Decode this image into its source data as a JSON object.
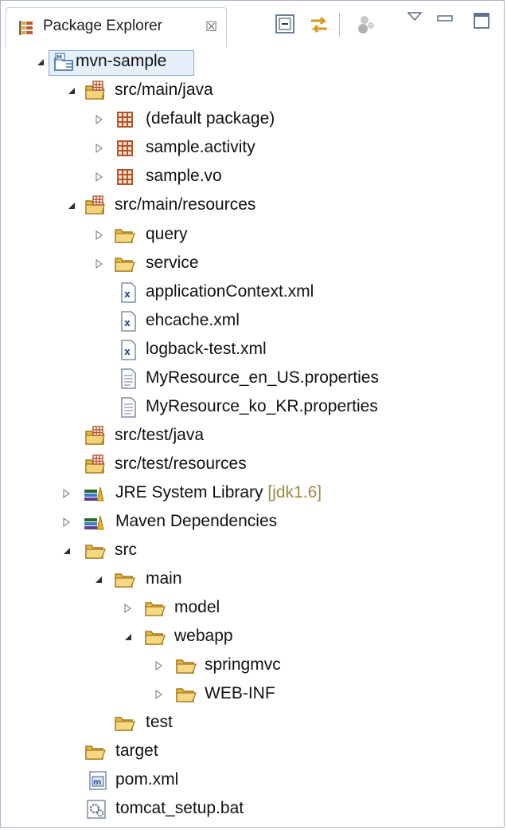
{
  "view": {
    "title": "Package Explorer",
    "close_glyph": "☒",
    "toolbar": [
      {
        "name": "collapse-all-icon"
      },
      {
        "name": "link-with-editor-icon"
      },
      {
        "name": "filters-icon"
      },
      {
        "name": "view-menu-icon"
      },
      {
        "name": "minimize-icon"
      },
      {
        "name": "maximize-icon"
      }
    ]
  },
  "tree": [
    {
      "label": "mvn-sample",
      "icon": "maven-project-icon",
      "twisty": "expanded",
      "selected": true
    },
    {
      "label": "src/main/java",
      "icon": "source-folder-icon",
      "twisty": "expanded"
    },
    {
      "label": "(default package)",
      "icon": "package-icon",
      "twisty": "collapsed"
    },
    {
      "label": "sample.activity",
      "icon": "package-icon",
      "twisty": "collapsed"
    },
    {
      "label": "sample.vo",
      "icon": "package-icon",
      "twisty": "collapsed"
    },
    {
      "label": "src/main/resources",
      "icon": "source-folder-icon",
      "twisty": "expanded"
    },
    {
      "label": "query",
      "icon": "folder-icon",
      "twisty": "collapsed"
    },
    {
      "label": "service",
      "icon": "folder-icon",
      "twisty": "collapsed"
    },
    {
      "label": "applicationContext.xml",
      "icon": "xml-file-icon",
      "twisty": "none"
    },
    {
      "label": "ehcache.xml",
      "icon": "xml-file-icon",
      "twisty": "none"
    },
    {
      "label": "logback-test.xml",
      "icon": "xml-file-icon",
      "twisty": "none"
    },
    {
      "label": "MyResource_en_US.properties",
      "icon": "text-file-icon",
      "twisty": "none"
    },
    {
      "label": "MyResource_ko_KR.properties",
      "icon": "text-file-icon",
      "twisty": "none"
    },
    {
      "label": "src/test/java",
      "icon": "source-folder-icon",
      "twisty": "none"
    },
    {
      "label": "src/test/resources",
      "icon": "source-folder-icon",
      "twisty": "none"
    },
    {
      "label": "JRE System Library",
      "decoration": "[jdk1.6]",
      "icon": "library-icon",
      "twisty": "collapsed"
    },
    {
      "label": "Maven Dependencies",
      "icon": "library-icon",
      "twisty": "collapsed"
    },
    {
      "label": "src",
      "icon": "folder-icon",
      "twisty": "expanded"
    },
    {
      "label": "main",
      "icon": "folder-icon",
      "twisty": "expanded"
    },
    {
      "label": "model",
      "icon": "folder-icon",
      "twisty": "collapsed"
    },
    {
      "label": "webapp",
      "icon": "folder-icon",
      "twisty": "expanded"
    },
    {
      "label": "springmvc",
      "icon": "folder-icon",
      "twisty": "collapsed"
    },
    {
      "label": "WEB-INF",
      "icon": "folder-icon",
      "twisty": "collapsed"
    },
    {
      "label": "test",
      "icon": "folder-icon",
      "twisty": "none"
    },
    {
      "label": "target",
      "icon": "folder-icon",
      "twisty": "none"
    },
    {
      "label": "pom.xml",
      "icon": "maven-pom-icon",
      "twisty": "none"
    },
    {
      "label": "tomcat_setup.bat",
      "icon": "batch-file-icon",
      "twisty": "none"
    }
  ],
  "colors": {
    "folder": "#e8b84a",
    "package": "#b5542b",
    "selection": "#e6f0fb",
    "decoration": "#9f8b3d"
  }
}
